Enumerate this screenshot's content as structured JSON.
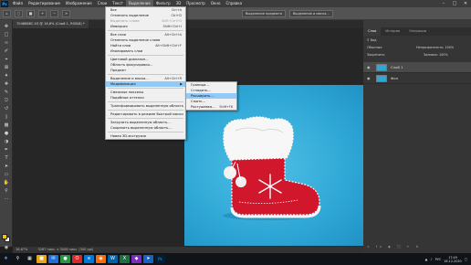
{
  "app": {
    "logo": "Ps"
  },
  "menubar": {
    "items": [
      "Файл",
      "Редактирование",
      "Изображение",
      "Слои",
      "Текст",
      "Выделение",
      "Фильтр",
      "3D",
      "Просмотр",
      "Окно",
      "Справка"
    ],
    "active_index": 5
  },
  "options_bar": {
    "buttons": [
      "Выделение предмета",
      "Выделение и маска..."
    ]
  },
  "document": {
    "tab_label": "7046888C.03 @ 16,6% (Слой 1, RGB/8) *",
    "zoom": "16,67%",
    "doc_info": "3267 пикс. x 3006 пикс. (300 ppi)"
  },
  "selection_menu": {
    "rows": [
      {
        "label": "Все",
        "shortcut": "Ctrl+A"
      },
      {
        "label": "Отменить выделение",
        "shortcut": "Ctrl+D"
      },
      {
        "label": "Выделить снова",
        "shortcut": "Shift+Ctrl+D",
        "disabled": true
      },
      {
        "label": "Инверсия",
        "shortcut": "Shift+Ctrl+I"
      },
      {
        "sep": true
      },
      {
        "label": "Все слои",
        "shortcut": "Alt+Ctrl+A"
      },
      {
        "label": "Отменить выделение слоев",
        "shortcut": ""
      },
      {
        "label": "Найти слои",
        "shortcut": "Alt+Shift+Ctrl+F"
      },
      {
        "label": "Изолировать слои",
        "shortcut": ""
      },
      {
        "sep": true
      },
      {
        "label": "Цветовой диапазон...",
        "shortcut": ""
      },
      {
        "label": "Область фокусировки...",
        "shortcut": ""
      },
      {
        "label": "Предмет",
        "shortcut": ""
      },
      {
        "sep": true
      },
      {
        "label": "Выделение и маска...",
        "shortcut": "Alt+Ctrl+R"
      },
      {
        "label": "Модификация",
        "shortcut": "",
        "submenu": true,
        "highlight": true
      },
      {
        "sep": true
      },
      {
        "label": "Смежные пикселы",
        "shortcut": ""
      },
      {
        "label": "Подобные оттенки",
        "shortcut": ""
      },
      {
        "sep": true
      },
      {
        "label": "Трансформировать выделенную область",
        "shortcut": ""
      },
      {
        "sep": true
      },
      {
        "label": "Редактировать в режиме быстрой маски",
        "shortcut": ""
      },
      {
        "sep": true
      },
      {
        "label": "Загрузить выделенную область...",
        "shortcut": ""
      },
      {
        "label": "Сохранить выделенную область...",
        "shortcut": ""
      },
      {
        "sep": true
      },
      {
        "label": "Новая 3D-экструзия",
        "shortcut": ""
      }
    ]
  },
  "modify_submenu": {
    "rows": [
      {
        "label": "Граница...",
        "shortcut": ""
      },
      {
        "label": "Сгладить...",
        "shortcut": ""
      },
      {
        "label": "Расширить...",
        "shortcut": "",
        "highlight": true
      },
      {
        "label": "Сжать...",
        "shortcut": ""
      },
      {
        "label": "Растушевка...",
        "shortcut": "Shift+F6"
      }
    ]
  },
  "panels": {
    "tabs": [
      "Слои",
      "История",
      "Операции"
    ],
    "search_placeholder": "Вид",
    "blend_mode": "Обычные",
    "opacity_label": "Непрозрачность: 100%",
    "lock_label": "Закрепить:",
    "fill_label": "Заливка: 100%",
    "layers": [
      {
        "name": "Слой 1",
        "selected": true
      },
      {
        "name": "Фон",
        "selected": false
      }
    ]
  },
  "taskbar": {
    "lang": "РУС",
    "time": "17:49",
    "date": "18.12.2020"
  },
  "colors": {
    "foreground": "#f5c400",
    "background": "#ffffff",
    "image_bg": "#2fa7d6",
    "boot_red": "#d0172b"
  }
}
